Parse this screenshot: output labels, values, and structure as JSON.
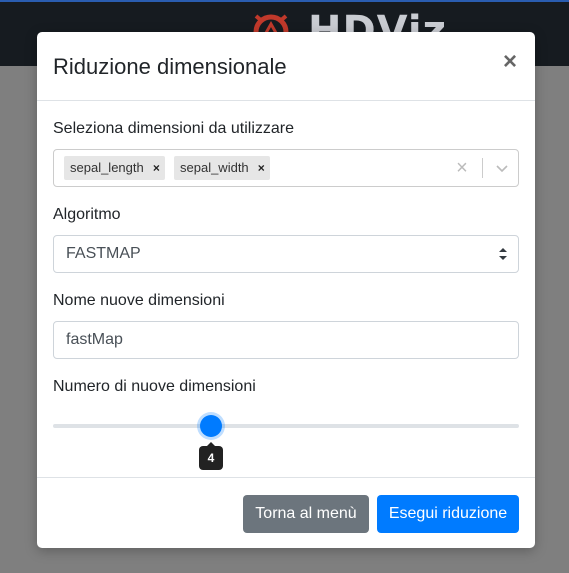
{
  "app": {
    "logo_text": "HDViz"
  },
  "modal": {
    "title": "Riduzione dimensionale",
    "close_label": "×",
    "dimensions": {
      "label": "Seleziona dimensioni da utilizzare",
      "selected": [
        "sepal_length",
        "sepal_width"
      ],
      "remove_glyph": "×",
      "clear_glyph": "×"
    },
    "algorithm": {
      "label": "Algoritmo",
      "value": "FASTMAP"
    },
    "new_names": {
      "label": "Nome nuove dimensioni",
      "value": "fastMap"
    },
    "count": {
      "label": "Numero di nuove dimensioni",
      "value": 4,
      "value_text": "4"
    },
    "footer": {
      "back_label": "Torna al menù",
      "run_label": "Esegui riduzione"
    }
  },
  "colors": {
    "primary": "#007bff",
    "secondary": "#6c757d",
    "topbar": "#161b20"
  }
}
